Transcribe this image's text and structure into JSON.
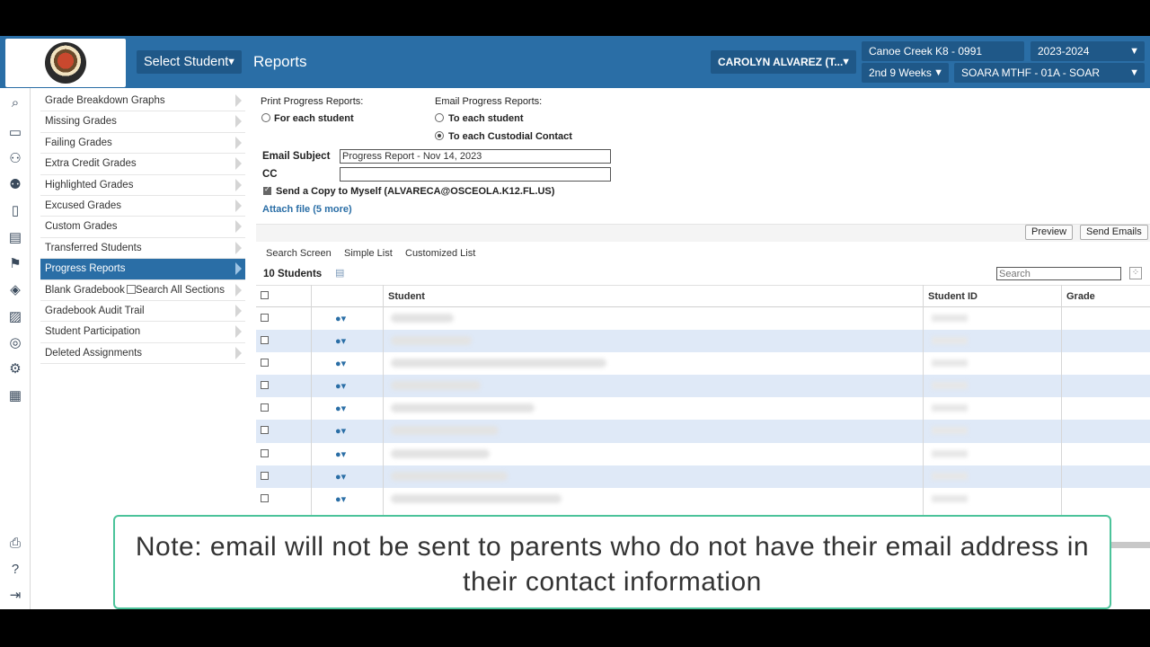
{
  "header": {
    "select_student_label": "Select Student",
    "page_title": "Reports",
    "teacher": "CAROLYN ALVAREZ (T...",
    "school": "Canoe Creek K8 - 0991",
    "year": "2023-2024",
    "term": "2nd 9 Weeks",
    "section": "SOARA MTHF - 01A - SOAR"
  },
  "rail_icons": [
    "search-icon",
    "monitor-icon",
    "person-switch-icon",
    "people-icon",
    "book-icon",
    "report-card-icon",
    "flag-icon",
    "graduation-cap-icon",
    "chart-icon",
    "lifebuoy-icon",
    "gear-icon",
    "calendar-icon",
    "print-icon",
    "help-icon",
    "logout-icon"
  ],
  "menu": {
    "items": [
      "Grade Breakdown Graphs",
      "Missing Grades",
      "Failing Grades",
      "Extra Credit Grades",
      "Highlighted Grades",
      "Excused Grades",
      "Custom Grades",
      "Transferred Students",
      "Progress Reports",
      "Blank Gradebook",
      "Gradebook Audit Trail",
      "Student Participation",
      "Deleted Assignments"
    ],
    "active_index": 8,
    "search_all_sections_label": "Search All Sections"
  },
  "form": {
    "print_heading": "Print Progress Reports:",
    "print_each_student": "For each student",
    "email_heading": "Email Progress Reports:",
    "email_each_student": "To each student",
    "email_each_contact": "To each Custodial Contact",
    "email_subject_label": "Email Subject",
    "email_subject_value": "Progress Report - Nov 14, 2023",
    "cc_label": "CC",
    "cc_value": "",
    "send_copy_label": "Send a Copy to Myself (ALVARECA@OSCEOLA.K12.FL.US)",
    "attach_label": "Attach file (5 more)"
  },
  "toolbar": {
    "preview_label": "Preview",
    "send_label": "Send Emails",
    "tabs": [
      "Search Screen",
      "Simple List",
      "Customized List"
    ],
    "count_label": "10 Students",
    "search_placeholder": "Search"
  },
  "table": {
    "columns": [
      "Student",
      "Student ID",
      "Grade"
    ],
    "row_count_visible": 9
  },
  "note": "Note: email will not be sent to parents who do not have their email address in their contact information",
  "colors": {
    "header_blue": "#2a6ea6",
    "row_alt": "#dfe9f7",
    "note_border": "#4bc39a"
  }
}
